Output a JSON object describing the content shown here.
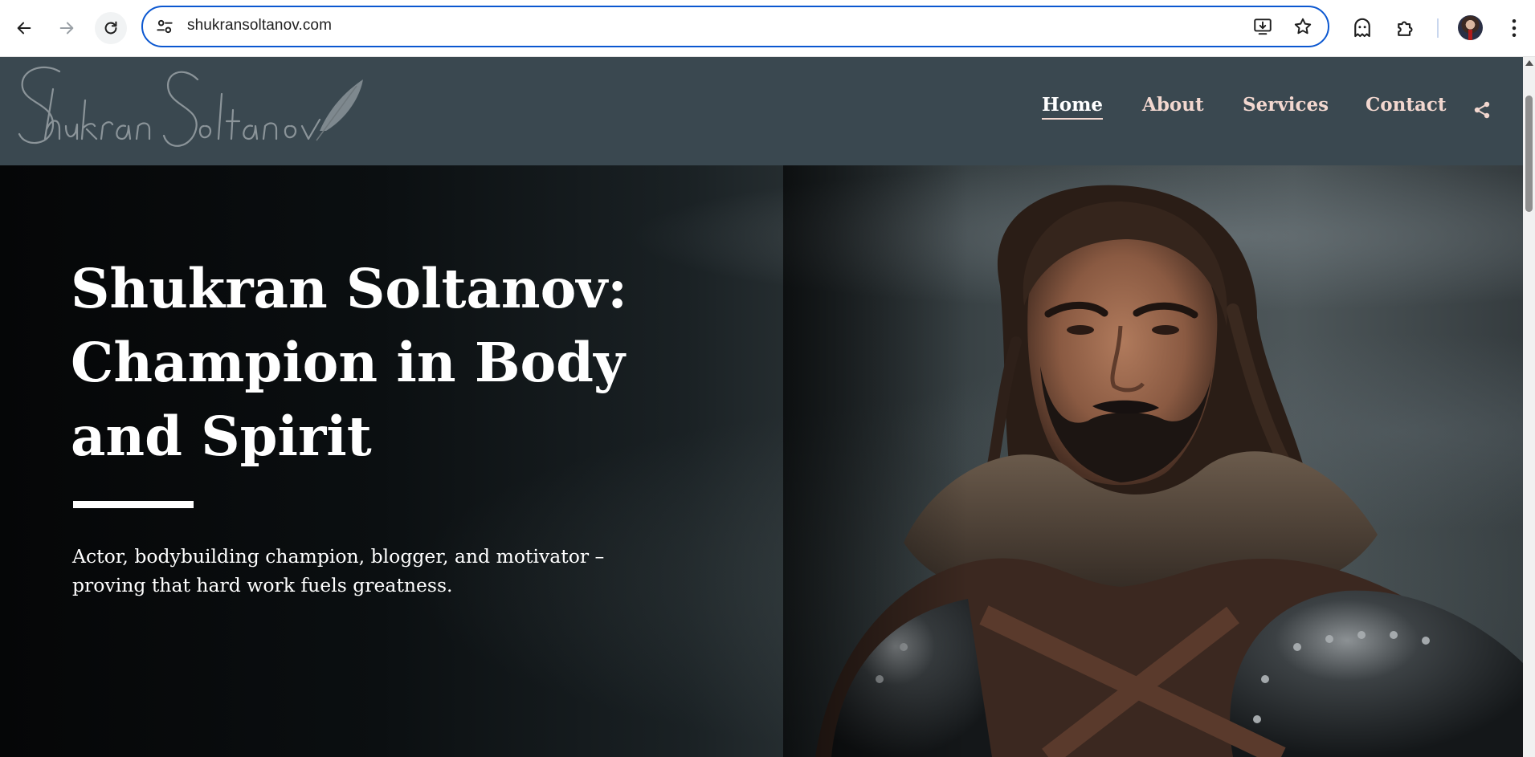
{
  "browser": {
    "url": "shukransoltanov.com"
  },
  "site": {
    "logo_text": "Shukran Soltanov",
    "nav": [
      {
        "label": "Home",
        "active": true
      },
      {
        "label": "About",
        "active": false
      },
      {
        "label": "Services",
        "active": false
      },
      {
        "label": "Contact",
        "active": false
      }
    ]
  },
  "hero": {
    "title": "Shukran Soltanov: Champion in Body and Spirit",
    "subtitle": "Actor, bodybuilding champion, blogger, and motivator – proving that hard work fuels greatness."
  },
  "colors": {
    "header_bg": "#3a4850",
    "nav_text": "#f2d7cf",
    "omnibox_border": "#0b57d0"
  },
  "icons": {
    "back": "arrow-left-icon",
    "forward": "arrow-right-icon",
    "reload": "reload-icon",
    "site_info": "tune-icon",
    "install": "install-app-icon",
    "bookmark": "star-icon",
    "extension_ghost": "ghost-icon",
    "extensions": "puzzle-icon",
    "menu": "kebab-menu-icon",
    "share": "share-icon"
  }
}
